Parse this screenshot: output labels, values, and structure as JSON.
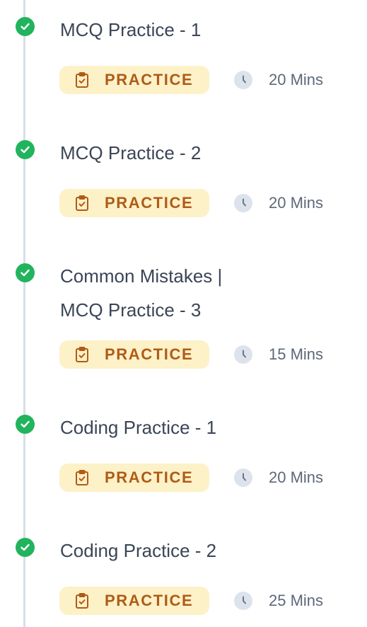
{
  "items": [
    {
      "title": "MCQ Practice - 1",
      "type_label": "PRACTICE",
      "duration": "20 Mins",
      "completed": true
    },
    {
      "title": "MCQ Practice - 2",
      "type_label": "PRACTICE",
      "duration": "20 Mins",
      "completed": true
    },
    {
      "title": "Common Mistakes |\nMCQ Practice - 3",
      "type_label": "PRACTICE",
      "duration": "15 Mins",
      "completed": true
    },
    {
      "title": "Coding Practice - 1",
      "type_label": "PRACTICE",
      "duration": "20 Mins",
      "completed": true
    },
    {
      "title": "Coding Practice - 2",
      "type_label": "PRACTICE",
      "duration": "25 Mins",
      "completed": true
    }
  ],
  "icons": {
    "status": "check-circle-icon",
    "type": "clipboard-check-icon",
    "duration": "clock-icon"
  },
  "colors": {
    "completed": "#22b35e",
    "badge_background": "#fdf1c8",
    "badge_text": "#b05b16",
    "title_text": "#3a4556",
    "duration_text": "#5c6878",
    "timeline": "#d7dee7"
  }
}
